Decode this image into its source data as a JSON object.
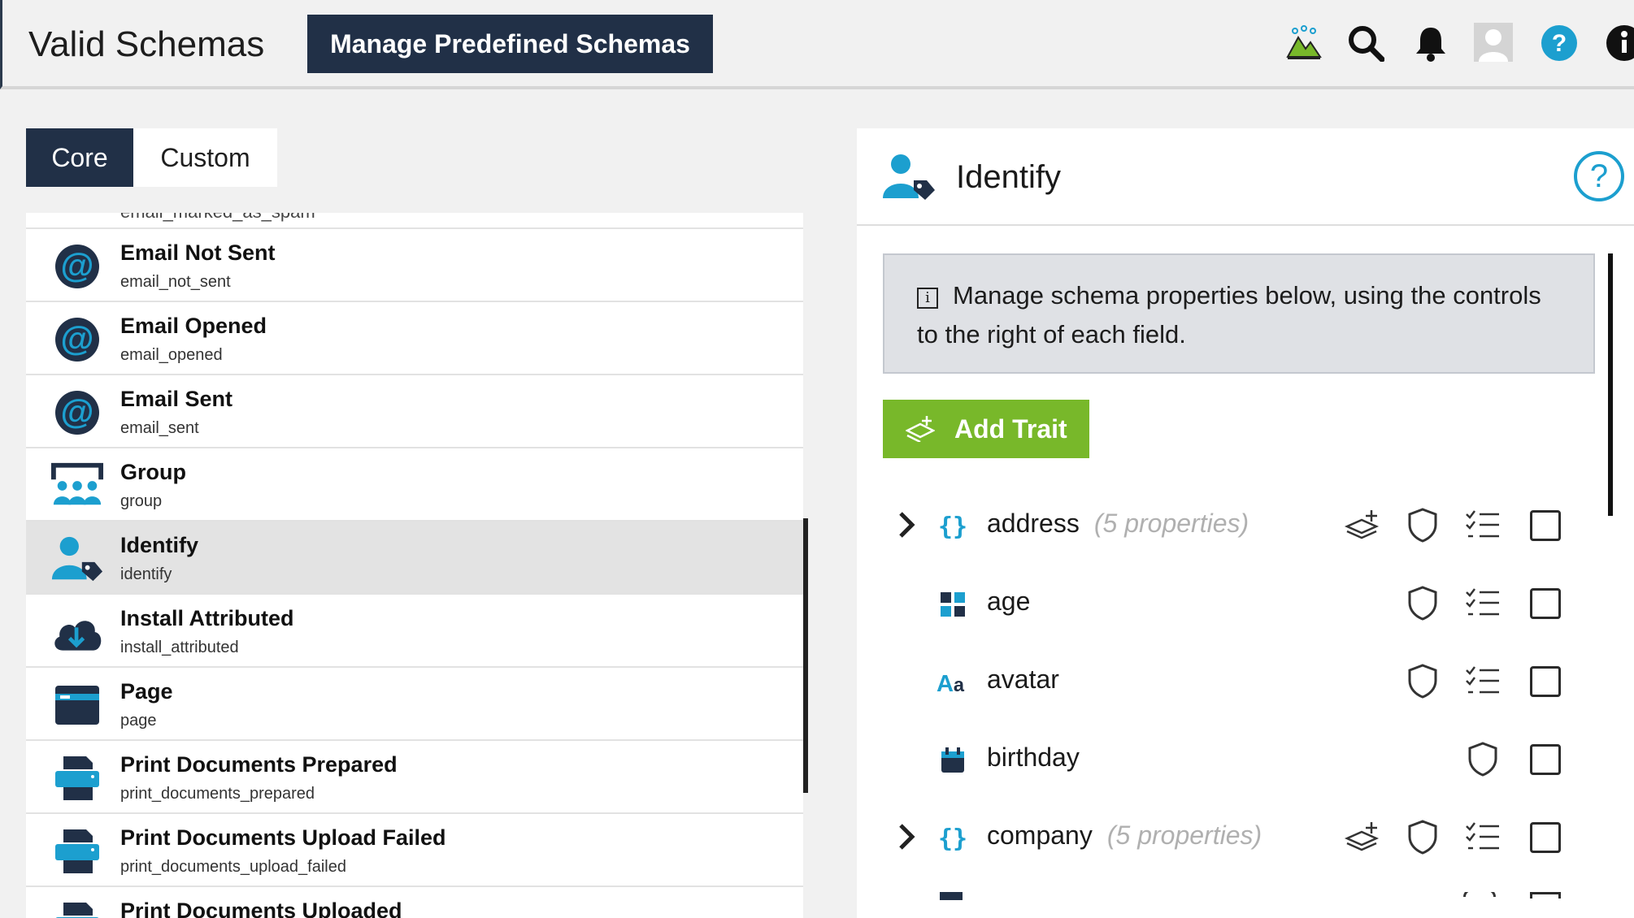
{
  "header": {
    "title": "Valid Schemas",
    "manage_button": "Manage Predefined Schemas",
    "icons": [
      "source-icon",
      "search-icon",
      "bell-icon",
      "avatar",
      "help-icon",
      "info-icon"
    ]
  },
  "colors": {
    "navy": "#213047",
    "accent_blue": "#1c9fcf",
    "green": "#78b82a"
  },
  "tabs": {
    "core": "Core",
    "custom": "Custom",
    "active": "Core"
  },
  "events": {
    "cut_top_slug": "email_marked_as_spam",
    "items": [
      {
        "name": "Email Not Sent",
        "slug": "email_not_sent",
        "icon": "at-icon"
      },
      {
        "name": "Email Opened",
        "slug": "email_opened",
        "icon": "at-icon"
      },
      {
        "name": "Email Sent",
        "slug": "email_sent",
        "icon": "at-icon"
      },
      {
        "name": "Group",
        "slug": "group",
        "icon": "group-icon"
      },
      {
        "name": "Identify",
        "slug": "identify",
        "icon": "identify-icon",
        "selected": true
      },
      {
        "name": "Install Attributed",
        "slug": "install_attributed",
        "icon": "cloud-download-icon"
      },
      {
        "name": "Page",
        "slug": "page",
        "icon": "page-icon"
      },
      {
        "name": "Print Documents Prepared",
        "slug": "print_documents_prepared",
        "icon": "printer-icon"
      },
      {
        "name": "Print Documents Upload Failed",
        "slug": "print_documents_upload_failed",
        "icon": "printer-icon"
      },
      {
        "name": "Print Documents Uploaded",
        "slug": "",
        "icon": "printer-icon"
      }
    ]
  },
  "detail": {
    "title": "Identify",
    "info_text": "Manage schema properties below, using the controls to the right of each field.",
    "add_trait": "Add Trait",
    "properties": [
      {
        "name": "address",
        "count": "(5 properties)",
        "type": "object-icon",
        "expandable": true
      },
      {
        "name": "age",
        "count": "",
        "type": "number-icon",
        "expandable": false
      },
      {
        "name": "avatar",
        "count": "",
        "type": "string-icon",
        "expandable": false
      },
      {
        "name": "birthday",
        "count": "",
        "type": "date-icon",
        "expandable": false
      },
      {
        "name": "company",
        "count": "(5 properties)",
        "type": "object-icon",
        "expandable": true
      }
    ]
  }
}
